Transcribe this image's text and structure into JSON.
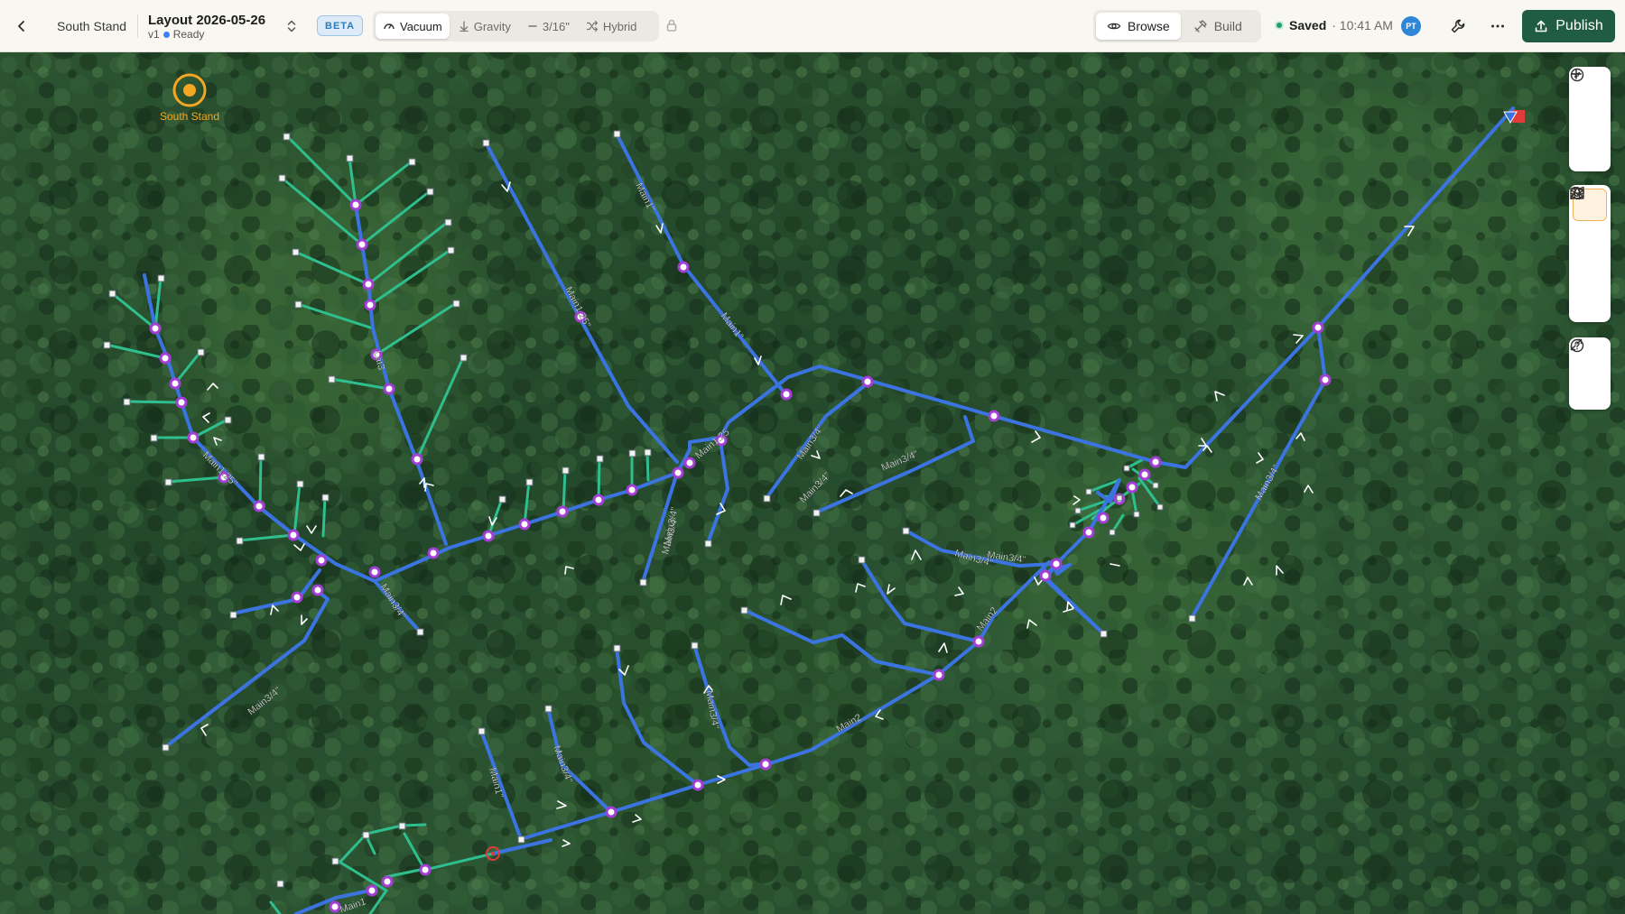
{
  "topbar": {
    "breadcrumb": "South Stand",
    "layout_title": "Layout 2026-05-26",
    "version": "v1",
    "status": "Ready",
    "beta_label": "BETA",
    "modes": [
      {
        "label": "Vacuum",
        "icon": "vacuum-gauge-icon",
        "active": true
      },
      {
        "label": "Gravity",
        "icon": "arrow-down-icon",
        "active": false
      },
      {
        "label": "3/16\"",
        "icon": "line-size-icon",
        "active": false
      },
      {
        "label": "Hybrid",
        "icon": "shuffle-icon",
        "active": false
      }
    ],
    "view": {
      "browse_label": "Browse",
      "build_label": "Build",
      "active": "Browse"
    },
    "saved_label": "Saved",
    "saved_time": "· 10:41 AM",
    "avatar_initials": "PT",
    "publish_label": "Publish"
  },
  "map": {
    "location_marker_label": "South Stand",
    "line_labels": [
      "Main1\"",
      "Main1.25\"",
      "Main1\"",
      "Main3/4\"",
      "Main3/4\"",
      "Main3/4\"",
      "Main3/4\"",
      "Main3/4\"",
      "Main2",
      "Main2",
      "Main3/4\"",
      "Main3/4\"",
      "Main3/4\"",
      "Main1\"",
      "Main3/4\"",
      "Main1.25\"",
      "Main3/4\"",
      "Main1.25",
      "Main3/4\"",
      "Main3/4\"",
      "Lat3",
      "Main1"
    ],
    "colors": {
      "main_line": "#3b74e0",
      "lateral_line": "#2fbf8f",
      "node_fill": "#ffffff",
      "node_stroke": "#a43fd6",
      "marker": "#f5a623",
      "pump": "#e23b3b"
    }
  },
  "map_tools": {
    "group1": [
      "plus-icon",
      "minus-icon",
      "compass-icon"
    ],
    "group2": [
      "layers-icon",
      "map-icon",
      "terrain-icon",
      "elevation-profile-icon"
    ],
    "group3": [
      "expand-icon",
      "help-icon"
    ]
  }
}
